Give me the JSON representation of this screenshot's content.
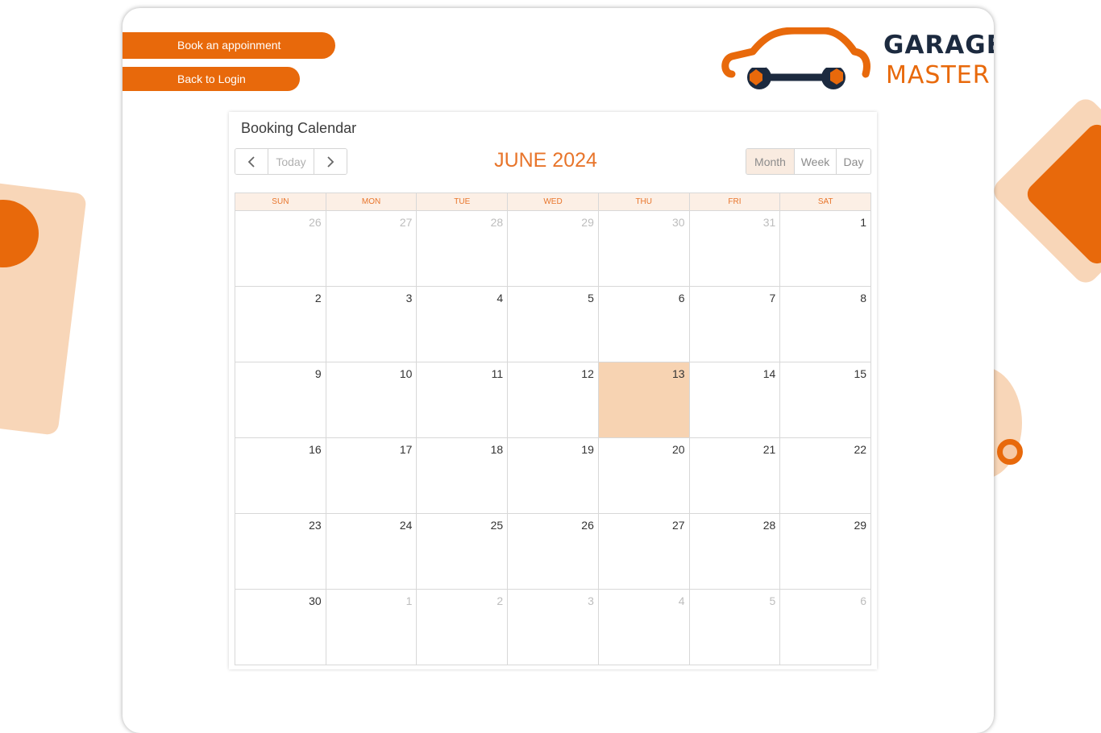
{
  "buttons": {
    "book": "Book an appoinment",
    "login": "Back to Login"
  },
  "logo": {
    "line1": "GARAGE",
    "line2": "MASTER",
    "colors": {
      "navy": "#1c2a3f",
      "orange": "#e8690b"
    }
  },
  "calendar": {
    "title": "Booking Calendar",
    "month_label": "JUNE 2024",
    "nav": {
      "prev_icon": "chevron-left-icon",
      "today": "Today",
      "next_icon": "chevron-right-icon"
    },
    "views": {
      "month": "Month",
      "week": "Week",
      "day": "Day",
      "active": "Month"
    },
    "weekdays": [
      "SUN",
      "MON",
      "TUE",
      "WED",
      "THU",
      "FRI",
      "SAT"
    ],
    "weeks": [
      [
        {
          "d": "26",
          "o": true
        },
        {
          "d": "27",
          "o": true
        },
        {
          "d": "28",
          "o": true
        },
        {
          "d": "29",
          "o": true
        },
        {
          "d": "30",
          "o": true
        },
        {
          "d": "31",
          "o": true
        },
        {
          "d": "1"
        }
      ],
      [
        {
          "d": "2"
        },
        {
          "d": "3"
        },
        {
          "d": "4"
        },
        {
          "d": "5"
        },
        {
          "d": "6"
        },
        {
          "d": "7"
        },
        {
          "d": "8"
        }
      ],
      [
        {
          "d": "9"
        },
        {
          "d": "10"
        },
        {
          "d": "11"
        },
        {
          "d": "12"
        },
        {
          "d": "13",
          "today": true
        },
        {
          "d": "14"
        },
        {
          "d": "15"
        }
      ],
      [
        {
          "d": "16"
        },
        {
          "d": "17"
        },
        {
          "d": "18"
        },
        {
          "d": "19"
        },
        {
          "d": "20"
        },
        {
          "d": "21"
        },
        {
          "d": "22"
        }
      ],
      [
        {
          "d": "23"
        },
        {
          "d": "24"
        },
        {
          "d": "25"
        },
        {
          "d": "26"
        },
        {
          "d": "27"
        },
        {
          "d": "28"
        },
        {
          "d": "29"
        }
      ],
      [
        {
          "d": "30"
        },
        {
          "d": "1",
          "o": true
        },
        {
          "d": "2",
          "o": true
        },
        {
          "d": "3",
          "o": true
        },
        {
          "d": "4",
          "o": true
        },
        {
          "d": "5",
          "o": true
        },
        {
          "d": "6",
          "o": true
        }
      ]
    ],
    "colors": {
      "accent": "#e8752b",
      "today_bg": "#f7d3b2",
      "header_bg": "#fcefe5"
    }
  }
}
